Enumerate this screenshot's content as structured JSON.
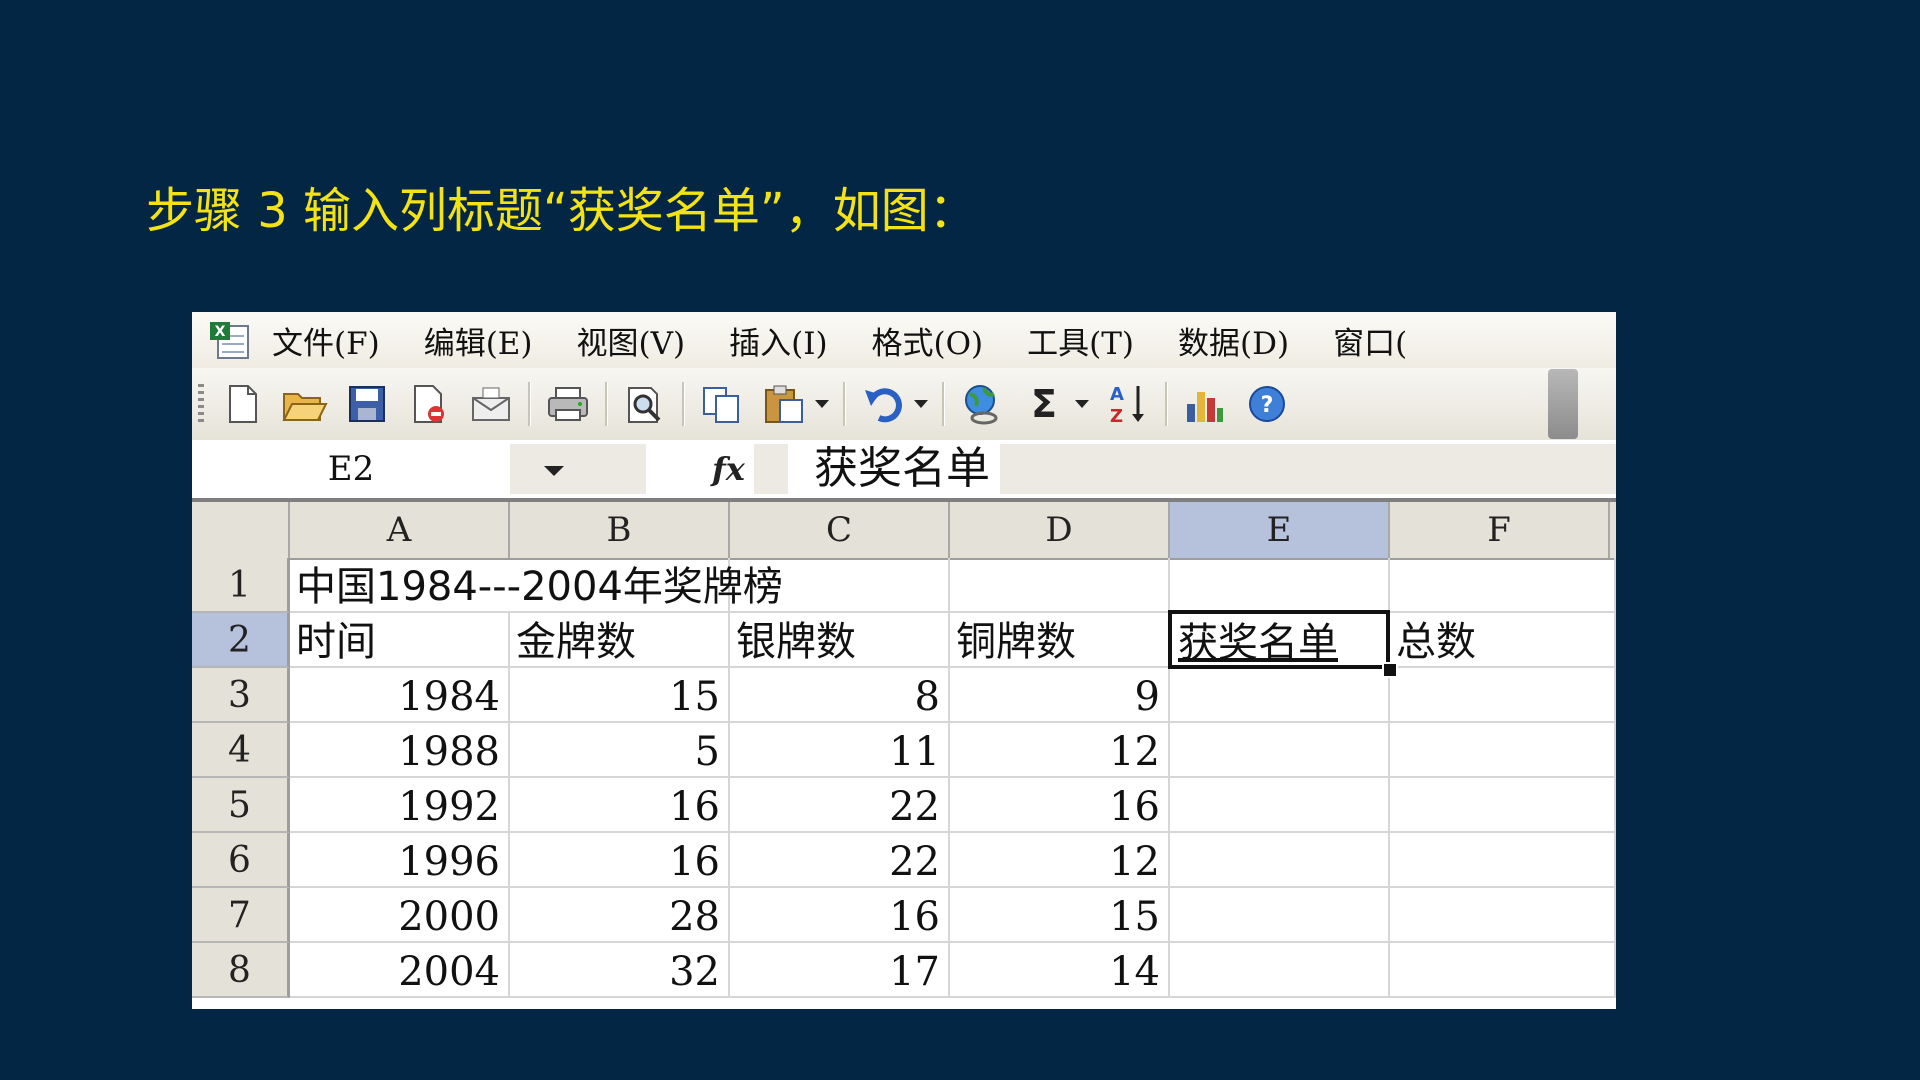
{
  "slide": {
    "title": "步骤 3 输入列标题“获奖名单”，如图："
  },
  "menu": [
    "文件(F)",
    "编辑(E)",
    "视图(V)",
    "插入(I)",
    "格式(O)",
    "工具(T)",
    "数据(D)",
    "窗口("
  ],
  "toolbar_icons": [
    "new-icon",
    "open-icon",
    "save-icon",
    "permission-icon",
    "email-icon",
    "print-icon",
    "print-preview-icon",
    "copy-icon",
    "paste-icon",
    "undo-icon",
    "hyperlink-icon",
    "autosum-icon",
    "sort-ascending-icon",
    "chart-wizard-icon",
    "help-icon"
  ],
  "formula_bar": {
    "name_box": "E2",
    "fx": "fx",
    "value": "获奖名单"
  },
  "columns": [
    "A",
    "B",
    "C",
    "D",
    "E",
    "F"
  ],
  "selected_column": "E",
  "selected_row": "2",
  "rows": [
    {
      "num": "1",
      "cells": [
        "中国1984---2004年奖牌榜",
        "",
        "",
        "",
        "",
        ""
      ]
    },
    {
      "num": "2",
      "cells": [
        "时间",
        "金牌数",
        "银牌数",
        "铜牌数",
        "获奖名单",
        "总数"
      ]
    },
    {
      "num": "3",
      "cells": [
        "1984",
        "15",
        "8",
        "9",
        "",
        ""
      ]
    },
    {
      "num": "4",
      "cells": [
        "1988",
        "5",
        "11",
        "12",
        "",
        ""
      ]
    },
    {
      "num": "5",
      "cells": [
        "1992",
        "16",
        "22",
        "16",
        "",
        ""
      ]
    },
    {
      "num": "6",
      "cells": [
        "1996",
        "16",
        "22",
        "12",
        "",
        ""
      ]
    },
    {
      "num": "7",
      "cells": [
        "2000",
        "28",
        "16",
        "15",
        "",
        ""
      ]
    },
    {
      "num": "8",
      "cells": [
        "2004",
        "32",
        "17",
        "14",
        "",
        ""
      ]
    }
  ]
}
